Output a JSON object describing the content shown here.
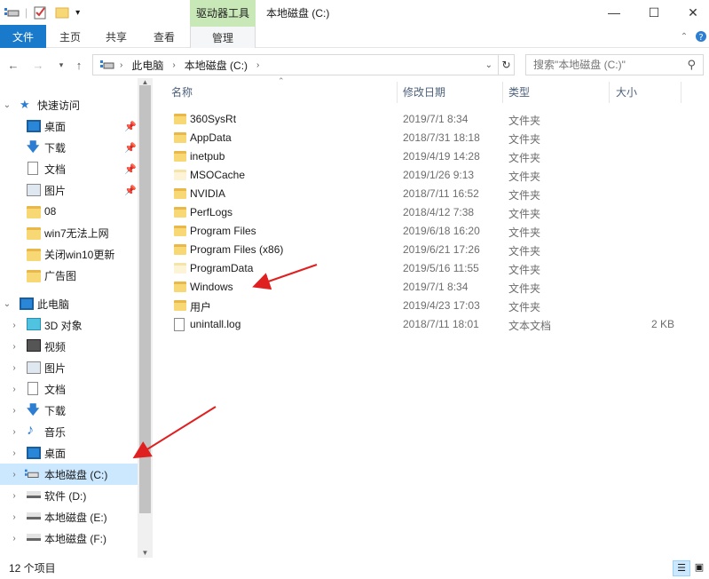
{
  "window": {
    "title": "本地磁盘 (C:)",
    "context_tab": "驱动器工具",
    "controls": [
      "minimize-icon",
      "maximize-icon",
      "close-icon"
    ]
  },
  "ribbon": {
    "tabs": [
      {
        "label": "文件"
      },
      {
        "label": "主页"
      },
      {
        "label": "共享"
      },
      {
        "label": "查看"
      },
      {
        "label": "管理"
      }
    ]
  },
  "address": {
    "crumbs": [
      "此电脑",
      "本地磁盘 (C:)"
    ],
    "search_placeholder": "搜索\"本地磁盘 (C:)\""
  },
  "nav": {
    "quick_access": "快速访问",
    "quick_items": [
      {
        "label": "桌面",
        "icon": "monitor-icon",
        "pinned": true
      },
      {
        "label": "下载",
        "icon": "download-icon",
        "pinned": true
      },
      {
        "label": "文档",
        "icon": "document-icon",
        "pinned": true
      },
      {
        "label": "图片",
        "icon": "pictures-icon",
        "pinned": true
      },
      {
        "label": "08",
        "icon": "folder-icon",
        "pinned": false
      },
      {
        "label": "win7无法上网",
        "icon": "folder-icon",
        "pinned": false
      },
      {
        "label": "关闭win10更新",
        "icon": "folder-icon",
        "pinned": false
      },
      {
        "label": "广告图",
        "icon": "folder-icon",
        "pinned": false
      }
    ],
    "this_pc": "此电脑",
    "pc_items": [
      {
        "label": "3D 对象",
        "icon": "cube-icon"
      },
      {
        "label": "视频",
        "icon": "video-icon"
      },
      {
        "label": "图片",
        "icon": "pictures-icon"
      },
      {
        "label": "文档",
        "icon": "document-icon"
      },
      {
        "label": "下载",
        "icon": "download-icon"
      },
      {
        "label": "音乐",
        "icon": "music-icon"
      },
      {
        "label": "桌面",
        "icon": "monitor-icon"
      },
      {
        "label": "本地磁盘 (C:)",
        "icon": "system-drive-icon",
        "selected": true
      },
      {
        "label": "软件 (D:)",
        "icon": "drive-icon"
      },
      {
        "label": "本地磁盘 (E:)",
        "icon": "drive-icon"
      },
      {
        "label": "本地磁盘 (F:)",
        "icon": "drive-icon"
      }
    ]
  },
  "columns": {
    "name": "名称",
    "date": "修改日期",
    "type": "类型",
    "size": "大小"
  },
  "files": [
    {
      "name": "360SysRt",
      "date": "2019/7/1 8:34",
      "type": "文件夹",
      "size": "",
      "icon": "folder-icon"
    },
    {
      "name": "AppData",
      "date": "2018/7/31 18:18",
      "type": "文件夹",
      "size": "",
      "icon": "folder-icon"
    },
    {
      "name": "inetpub",
      "date": "2019/4/19 14:28",
      "type": "文件夹",
      "size": "",
      "icon": "folder-icon"
    },
    {
      "name": "MSOCache",
      "date": "2019/1/26 9:13",
      "type": "文件夹",
      "size": "",
      "icon": "folder-icon"
    },
    {
      "name": "NVIDIA",
      "date": "2018/7/11 16:52",
      "type": "文件夹",
      "size": "",
      "icon": "folder-icon"
    },
    {
      "name": "PerfLogs",
      "date": "2018/4/12 7:38",
      "type": "文件夹",
      "size": "",
      "icon": "folder-icon"
    },
    {
      "name": "Program Files",
      "date": "2019/6/18 16:20",
      "type": "文件夹",
      "size": "",
      "icon": "folder-icon"
    },
    {
      "name": "Program Files (x86)",
      "date": "2019/6/21 17:26",
      "type": "文件夹",
      "size": "",
      "icon": "folder-icon"
    },
    {
      "name": "ProgramData",
      "date": "2019/5/16 11:55",
      "type": "文件夹",
      "size": "",
      "icon": "folder-icon"
    },
    {
      "name": "Windows",
      "date": "2019/7/1 8:34",
      "type": "文件夹",
      "size": "",
      "icon": "folder-icon"
    },
    {
      "name": "用户",
      "date": "2019/4/23 17:03",
      "type": "文件夹",
      "size": "",
      "icon": "folder-icon"
    },
    {
      "name": "unintall.log",
      "date": "2018/7/11 18:01",
      "type": "文本文档",
      "size": "2 KB",
      "icon": "text-file-icon"
    }
  ],
  "status": {
    "count": "12 个项目"
  },
  "colors": {
    "accent": "#1979ca",
    "context_tab": "#c9e8b8",
    "selection": "#cce8ff",
    "annotation_arrow": "#e02020"
  }
}
